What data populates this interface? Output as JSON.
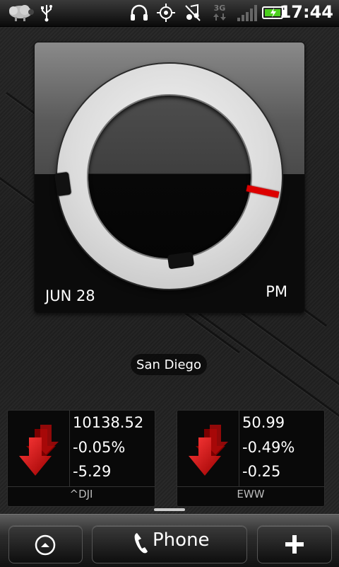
{
  "status_bar": {
    "time": "17:44",
    "network": "3G",
    "icons": [
      "notification-sheep-icon",
      "usb-icon",
      "headphones-icon",
      "gps-icon",
      "music-muted-icon",
      "3g-data-icon",
      "signal-icon",
      "battery-icon"
    ]
  },
  "clock_widget": {
    "date": "JUN 28",
    "ampm": "PM"
  },
  "location": "San Diego",
  "stocks": [
    {
      "price": "10138.52",
      "percent": "-0.05%",
      "change": "-5.29",
      "symbol": "^DJI"
    },
    {
      "price": "50.99",
      "percent": "-0.49%",
      "change": "-0.25",
      "symbol": "EWW"
    }
  ],
  "dock": {
    "phone_label": "Phone"
  },
  "colors": {
    "arrow_red": "#cc1414",
    "second_hand": "#dd0000"
  }
}
